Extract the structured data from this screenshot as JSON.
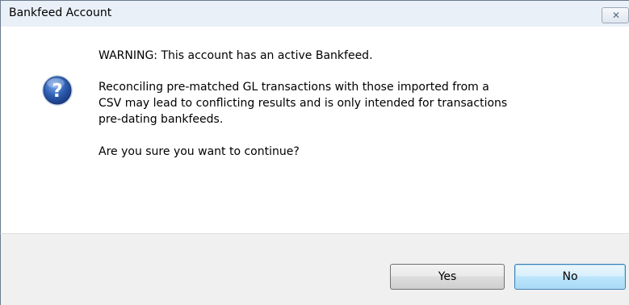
{
  "window": {
    "title": "Bankfeed Account",
    "close_glyph": "✕"
  },
  "message": {
    "icon": "question-icon",
    "warning": "WARNING: This account has an active Bankfeed.",
    "detail_lines": [
      "Reconciling pre-matched GL transactions with those imported from a",
      "CSV may lead to conflicting results and is only intended for transactions",
      "pre-dating bankfeeds."
    ],
    "question": "Are you sure you want to continue?"
  },
  "buttons": {
    "yes_label": "Yes",
    "no_label": "No"
  },
  "colors": {
    "titlebar": "#eaf0f8",
    "footer": "#f0f0f0",
    "icon_blue": "#2f5fb3",
    "default_button_border": "#3c7fb1"
  }
}
